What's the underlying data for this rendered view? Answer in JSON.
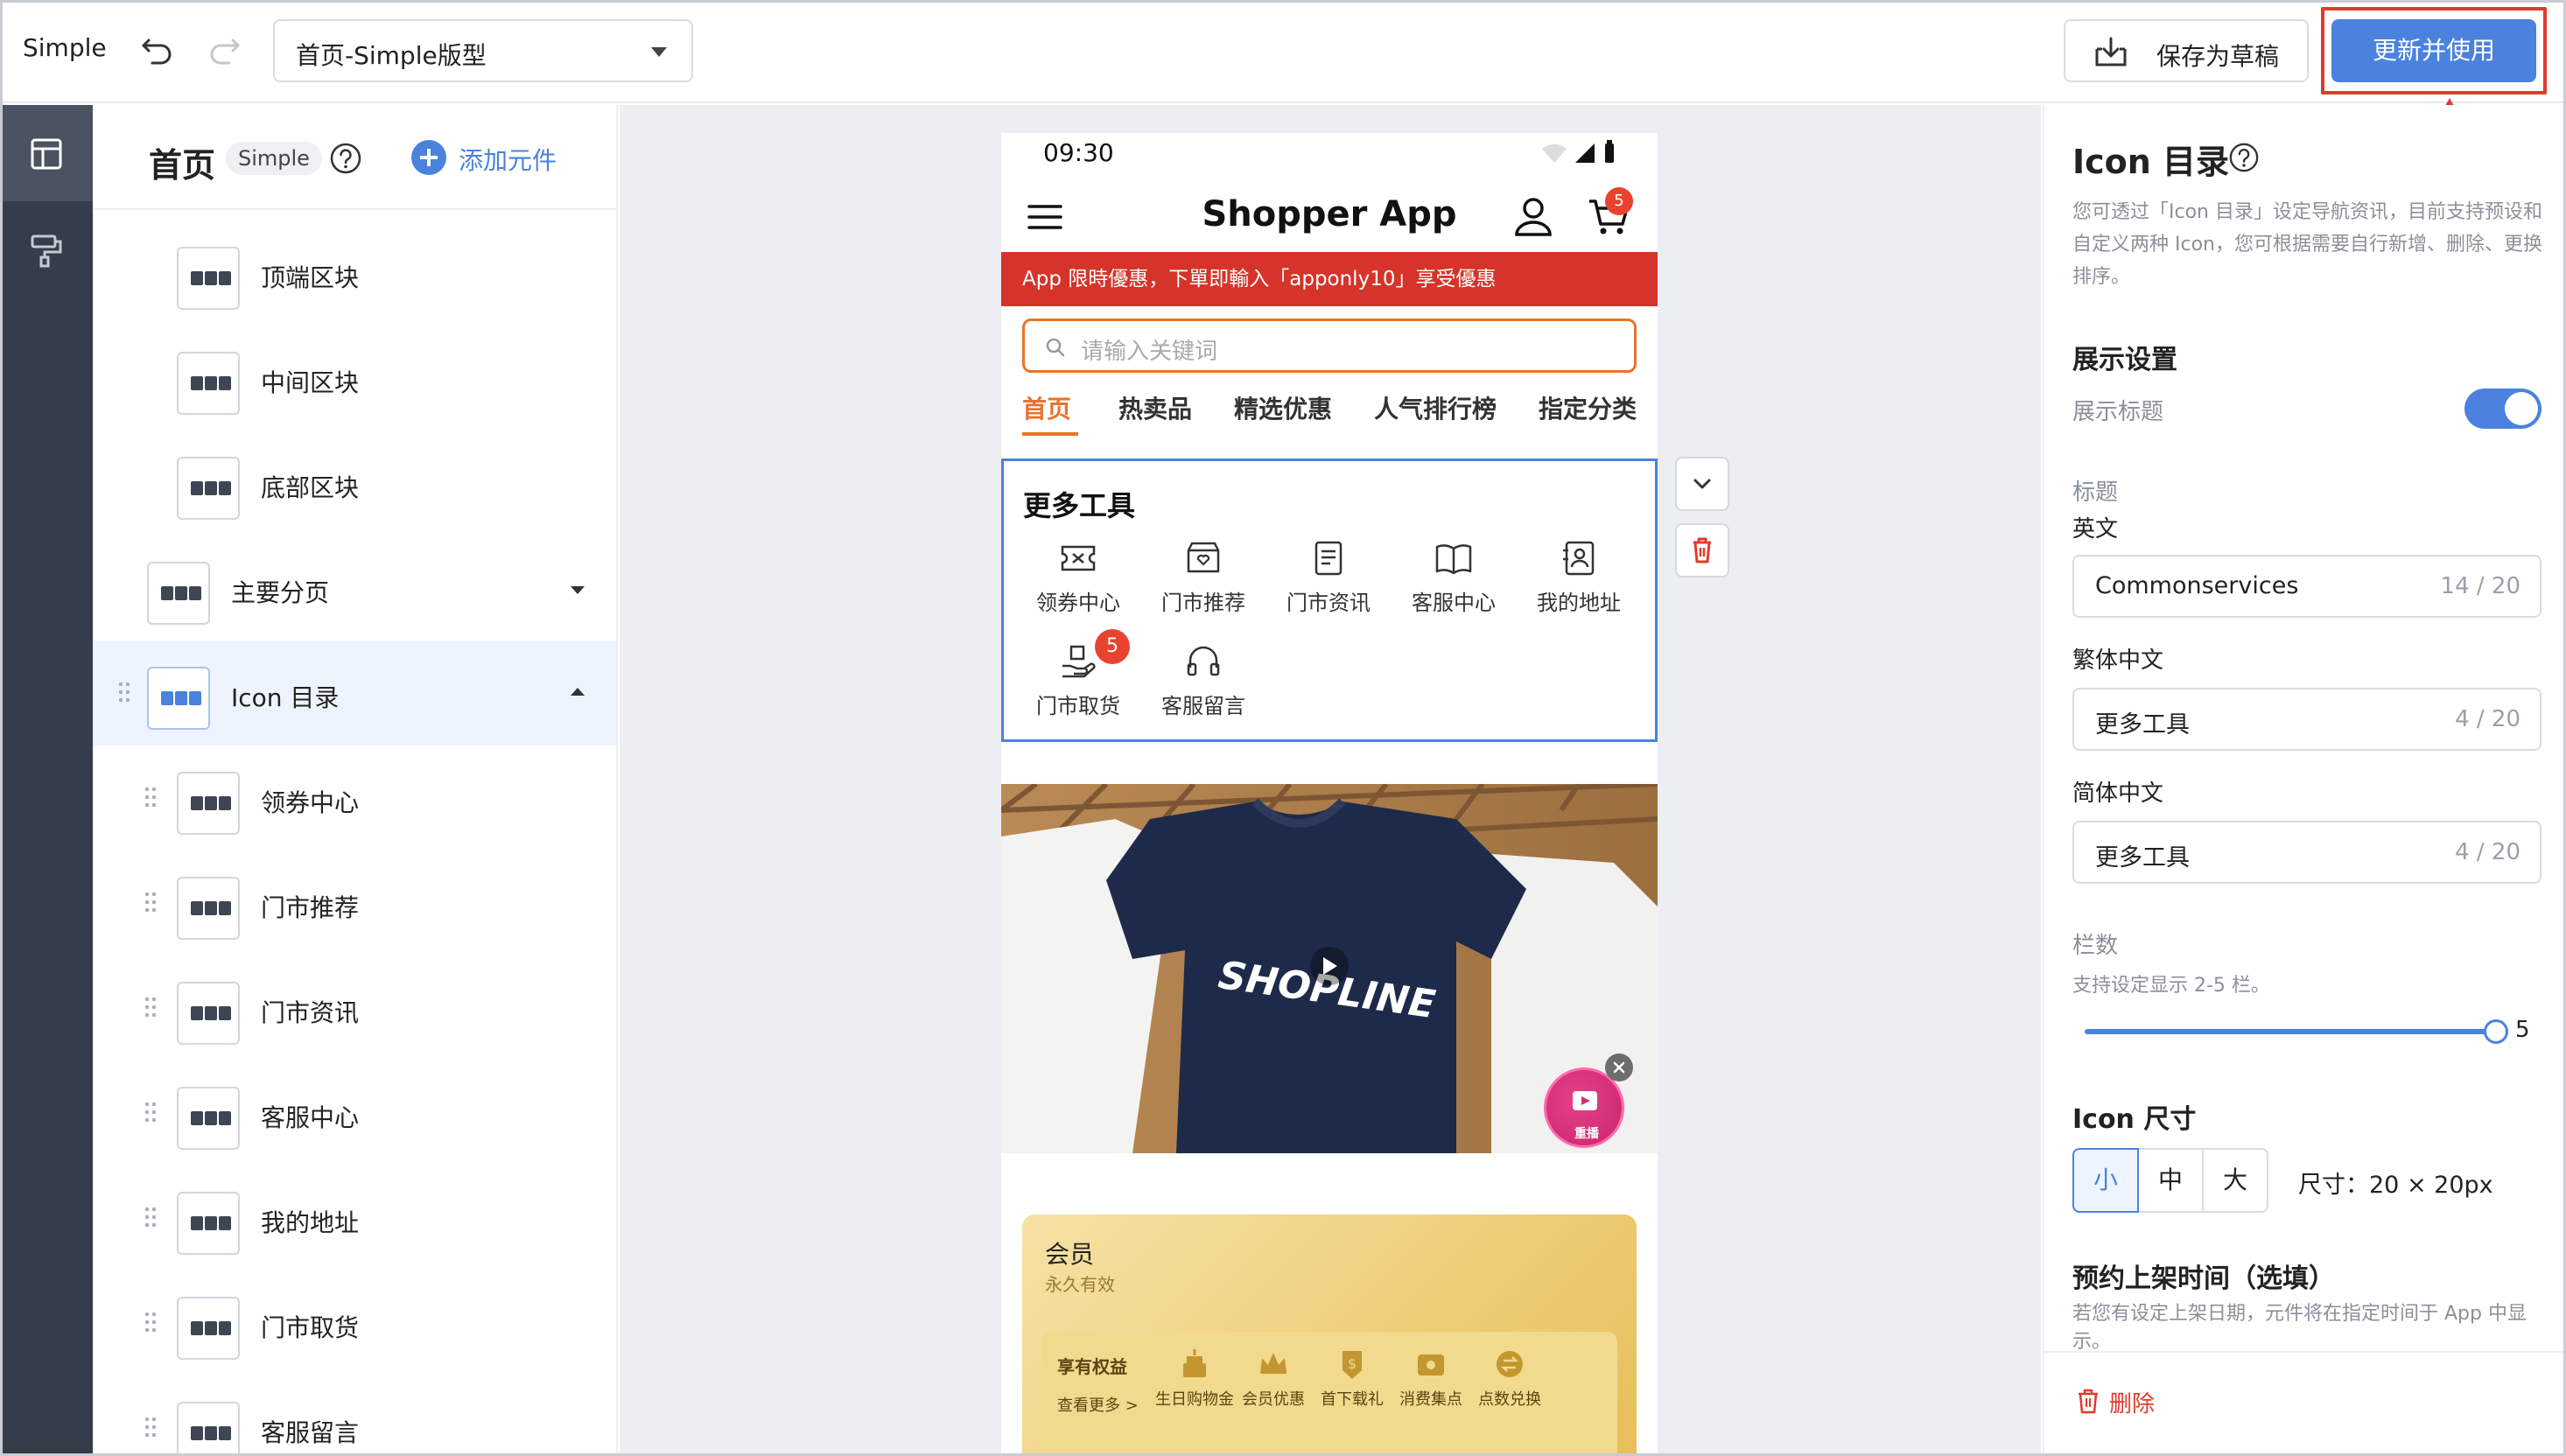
{
  "topbar": {
    "brand": "Simple",
    "page_select_value": "首页-Simple版型",
    "save_draft_label": "保存为草稿",
    "publish_label": "更新并使用",
    "annotation_color": "#e23a2c"
  },
  "tree": {
    "title": "首页",
    "tag": "Simple",
    "add_label": "添加元件",
    "items": [
      {
        "label": "顶端区块"
      },
      {
        "label": "中间区块"
      },
      {
        "label": "底部区块"
      },
      {
        "label": "主要分页"
      },
      {
        "label": "Icon 目录"
      },
      {
        "label": "领券中心"
      },
      {
        "label": "门市推荐"
      },
      {
        "label": "门市资讯"
      },
      {
        "label": "客服中心"
      },
      {
        "label": "我的地址"
      },
      {
        "label": "门市取货"
      },
      {
        "label": "客服留言"
      }
    ]
  },
  "phone": {
    "time": "09:30",
    "app_title": "Shopper App",
    "cart_count": "5",
    "promo": "App 限時優惠，下單即輸入「apponly10」享受優惠",
    "search_placeholder": "请输入关键词",
    "tabs": [
      "首页",
      "热卖品",
      "精选优惠",
      "人气排行榜",
      "指定分类"
    ],
    "tools_title": "更多工具",
    "tools": [
      {
        "label": "领券中心",
        "icon": "ticket-icon"
      },
      {
        "label": "门市推荐",
        "icon": "store-icon"
      },
      {
        "label": "门市资讯",
        "icon": "document-icon"
      },
      {
        "label": "客服中心",
        "icon": "book-icon"
      },
      {
        "label": "我的地址",
        "icon": "address-book-icon"
      },
      {
        "label": "门市取货",
        "icon": "hand-box-icon",
        "badge": "5"
      },
      {
        "label": "客服留言",
        "icon": "headset-icon"
      }
    ],
    "hero_text": "SHOPLINE",
    "live_label": "重播",
    "member": {
      "title": "会员",
      "subtitle": "永久有效",
      "benefits_title": "享有权益",
      "see_more": "查看更多 >",
      "perks": [
        "生日购物金",
        "会员优惠",
        "首下载礼",
        "消费集点",
        "点数兑换"
      ]
    },
    "accent_color": "#e8732c",
    "promo_color": "#d6332a"
  },
  "settings": {
    "title": "Icon 目录",
    "description": "您可透过「Icon 目录」设定导航资讯，目前支持预设和自定义两种 Icon，您可根据需要自行新增、删除、更换排序。",
    "display_heading": "展示设置",
    "show_title_label": "展示标题",
    "show_title_on": true,
    "title_label": "标题",
    "english_label": "英文",
    "english_value": "Commonservices",
    "english_count": "14 / 20",
    "trad_label": "繁体中文",
    "trad_value": "更多工具",
    "trad_count": "4 / 20",
    "simp_label": "简体中文",
    "simp_value": "更多工具",
    "simp_count": "4 / 20",
    "columns_label": "栏数",
    "columns_hint": "支持设定显示 2-5 栏。",
    "columns_value": "5",
    "columns_range": [
      2,
      5
    ],
    "icon_size_heading": "Icon 尺寸",
    "size_options": [
      "小",
      "中",
      "大"
    ],
    "size_selected": "小",
    "size_text": "尺寸：20 × 20px",
    "schedule_heading": "预约上架时间（选填）",
    "schedule_hint": "若您有设定上架日期，元件将在指定时间于 App 中显示。",
    "delete_label": "删除",
    "accent_color": "#4a82de"
  }
}
